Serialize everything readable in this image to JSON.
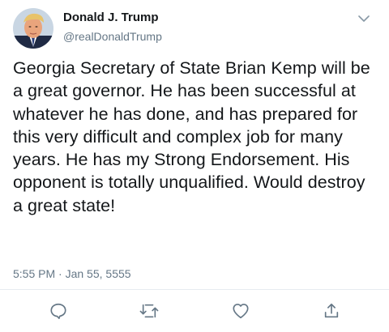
{
  "author": {
    "name": "Donald J. Trump",
    "handle": "@realDonaldTrump"
  },
  "tweet": {
    "text": "Georgia Secretary of State Brian Kemp will be a great governor. He has been successful at whatever he has done, and has prepared for this very difficult and complex job for many years. He has my Strong Endorsement. His opponent is totally unqualified. Would destroy a great state!"
  },
  "meta": {
    "time": "5:55 PM",
    "separator": "·",
    "date": "Jan 55, 5555"
  },
  "actions": [
    {
      "name": "reply",
      "icon": "reply-icon"
    },
    {
      "name": "retweet",
      "icon": "retweet-icon"
    },
    {
      "name": "like",
      "icon": "heart-icon"
    },
    {
      "name": "share",
      "icon": "share-icon"
    }
  ],
  "colors": {
    "text": "#14171a",
    "secondary": "#657786",
    "divider": "#e6ecf0"
  }
}
